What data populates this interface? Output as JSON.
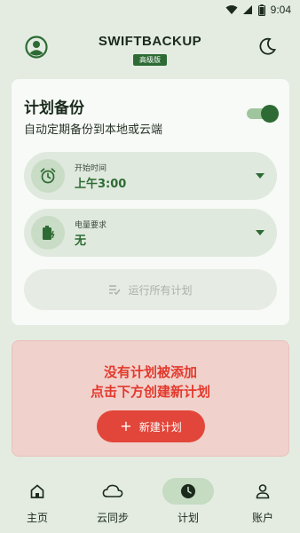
{
  "status_bar": {
    "time": "9:04"
  },
  "header": {
    "brand_title": "SWIFTBACKUP",
    "brand_badge": "高级版"
  },
  "schedule_card": {
    "title": "计划备份",
    "subtitle": "自动定期备份到本地或云端",
    "toggle_on": true,
    "start_time": {
      "label": "开始时间",
      "value": "上午3:00"
    },
    "power": {
      "label": "电量要求",
      "value": "无"
    },
    "run_all_label": "运行所有计划"
  },
  "empty_state": {
    "line1": "没有计划被添加",
    "line2": "点击下方创建新计划",
    "new_button_label": "新建计划"
  },
  "bottom_nav": {
    "items": [
      {
        "label": "主页",
        "icon": "home-icon"
      },
      {
        "label": "云同步",
        "icon": "cloud-icon"
      },
      {
        "label": "计划",
        "icon": "clock-icon",
        "active": true
      },
      {
        "label": "账户",
        "icon": "person-icon"
      }
    ]
  },
  "colors": {
    "accent": "#2e6b34",
    "danger": "#e3392c",
    "background": "#e4ece2"
  }
}
